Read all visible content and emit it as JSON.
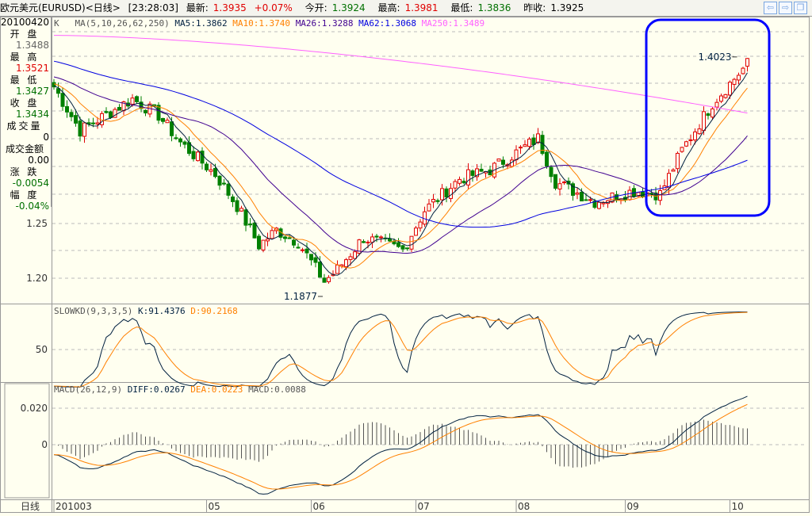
{
  "title": {
    "name": "欧元美元(EURUSD)<日线>",
    "time": "[23:28:03]",
    "latest_label": "最新:",
    "latest": "1.3935",
    "change": "+0.07%",
    "open_label": "今开:",
    "open": "1.3924",
    "high_label": "最高:",
    "high": "1.3981",
    "low_label": "最低:",
    "low": "1.3836",
    "prev_label": "昨收:",
    "prev": "1.3925"
  },
  "nav": {
    "back": "⇦",
    "forward": "⇨",
    "restore": "❐"
  },
  "info": {
    "date": "20100420",
    "open_label": "开 盘",
    "open": "1.3488",
    "high_label": "最 高",
    "high": "1.3521",
    "low_label": "最 低",
    "low": "1.3427",
    "close_label": "收 盘",
    "close": "1.3434",
    "volume_label": "成交量",
    "volume": "0",
    "amount_label": "成交金额",
    "amount": "0.00",
    "change_label": "涨 跌",
    "change": "-0.0054",
    "pct_label": "幅 度",
    "pct": "-0.04%"
  },
  "colors": {
    "up": "#e00000",
    "down": "#008000",
    "ma5": "#002040",
    "ma10": "#ff8000",
    "ma26": "#400090",
    "ma62": "#0000e0",
    "ma250": "#ff60ff",
    "highlight": "#0000ff"
  },
  "chart_data": [
    {
      "type": "candlestick",
      "title": "K",
      "legend": {
        "params": "MA(5,10,26,62,250)",
        "ma5": "MA5:1.3862",
        "ma10": "MA10:1.3740",
        "ma26": "MA26:1.3288",
        "ma62": "MA62:1.3068",
        "ma250": "MA250:1.3489"
      },
      "yticks": [
        "1.25",
        "1.20"
      ],
      "ytick_values": [
        1.25,
        1.2
      ],
      "close_anchors": [
        [
          0,
          1.375
        ],
        [
          6,
          1.335
        ],
        [
          18,
          1.364
        ],
        [
          24,
          1.349
        ],
        [
          29,
          1.324
        ],
        [
          37,
          1.295
        ],
        [
          42,
          1.266
        ],
        [
          47,
          1.23
        ],
        [
          51,
          1.244
        ],
        [
          56,
          1.233
        ],
        [
          62,
          1.197
        ],
        [
          65,
          1.208
        ],
        [
          71,
          1.237
        ],
        [
          80,
          1.226
        ],
        [
          85,
          1.262
        ],
        [
          93,
          1.291
        ],
        [
          100,
          1.299
        ],
        [
          111,
          1.328
        ],
        [
          115,
          1.288
        ],
        [
          124,
          1.27
        ],
        [
          133,
          1.28
        ],
        [
          139,
          1.277
        ],
        [
          144,
          1.317
        ],
        [
          151,
          1.36
        ],
        [
          159,
          1.396
        ]
      ],
      "ma250_range": [
        1.422,
        1.351
      ],
      "annotations": [
        {
          "text": "1.4023",
          "bar": 157,
          "price": 1.4023
        },
        {
          "text": "1.1877",
          "bar": 62,
          "price": 1.1877
        }
      ]
    },
    {
      "type": "line",
      "title": "SLOWKD(9,3,3,5)",
      "k_label": "K:91.4376",
      "d_label": "D:90.2168",
      "yticks": [
        "50"
      ]
    },
    {
      "type": "bar+line",
      "title": "MACD(26,12,9)",
      "diff_label": "DIFF:0.0267",
      "dea_label": "DEA:0.0223",
      "macd_label": "MACD:0.0088",
      "yticks": [
        "0.020",
        "0"
      ]
    }
  ],
  "xaxis": {
    "label": "日线",
    "months": [
      {
        "text": "201003",
        "bar": 0
      },
      {
        "text": "05",
        "bar": 35
      },
      {
        "text": "06",
        "bar": 59
      },
      {
        "text": "07",
        "bar": 83
      },
      {
        "text": "08",
        "bar": 106
      },
      {
        "text": "09",
        "bar": 131
      },
      {
        "text": "10",
        "bar": 155
      }
    ]
  }
}
